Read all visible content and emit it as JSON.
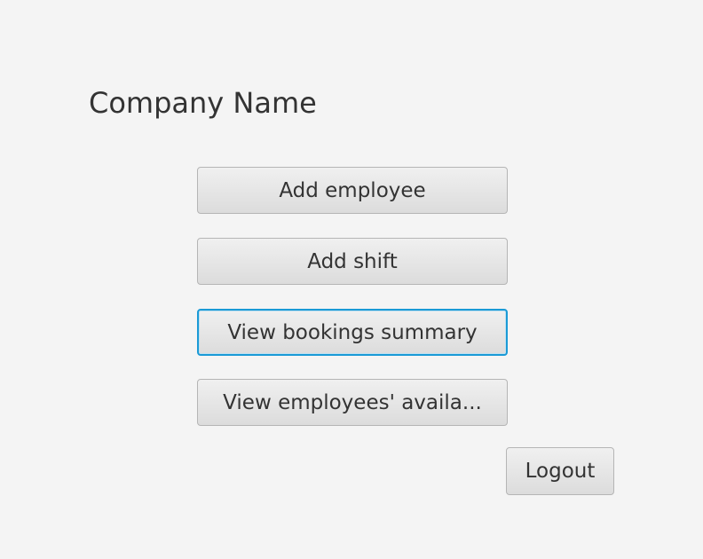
{
  "title": "Company Name",
  "buttons": {
    "add_employee": "Add employee",
    "add_shift": "Add shift",
    "view_bookings": "View bookings summary",
    "view_availability": "View employees' availa...",
    "logout": "Logout"
  },
  "colors": {
    "background": "#f4f4f4",
    "focus": "#1a9ad6"
  }
}
